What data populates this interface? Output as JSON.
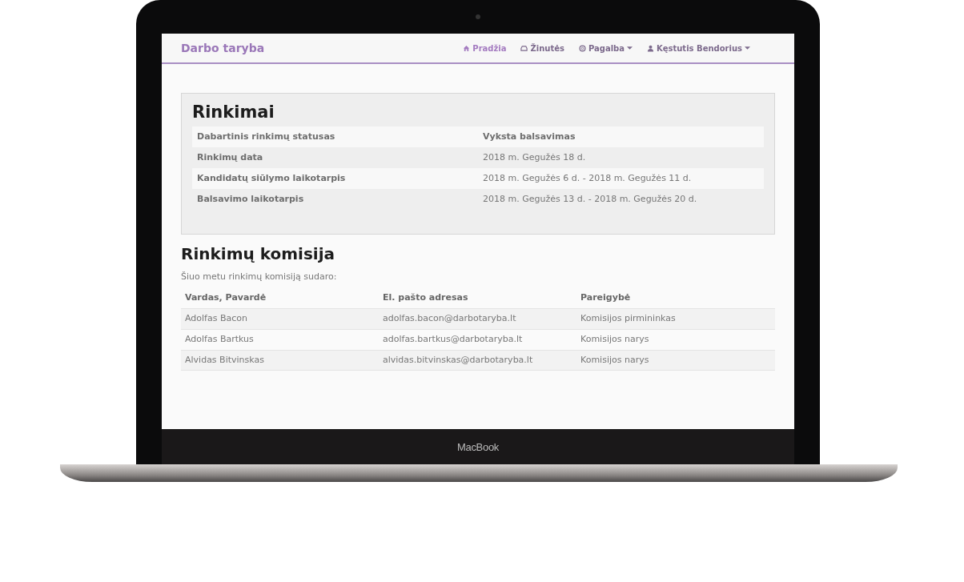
{
  "device": {
    "label": "MacBook"
  },
  "navbar": {
    "brand": "Darbo taryba",
    "items": [
      {
        "kind": "home",
        "label": "Pradžia",
        "dropdown": false
      },
      {
        "kind": "inbox",
        "label": "Žinutės",
        "dropdown": false
      },
      {
        "kind": "help",
        "label": "Pagalba",
        "dropdown": true
      },
      {
        "kind": "user",
        "label": "Kęstutis Bendorius",
        "dropdown": true
      }
    ]
  },
  "election": {
    "title": "Rinkimai",
    "rows": [
      {
        "label": "Dabartinis rinkimų statusas",
        "value": "Vyksta balsavimas",
        "bold": true
      },
      {
        "label": "Rinkimų data",
        "value": "2018 m. Gegužės 18 d.",
        "bold": false
      },
      {
        "label": "Kandidatų siūlymo laikotarpis",
        "value": "2018 m. Gegužės 6 d. - 2018 m. Gegužės 11 d.",
        "bold": false
      },
      {
        "label": "Balsavimo laikotarpis",
        "value": "2018 m. Gegužės 13 d. - 2018 m. Gegužės 20 d.",
        "bold": false
      }
    ]
  },
  "commission": {
    "title": "Rinkimų komisija",
    "intro": "Šiuo metu rinkimų komisiją sudaro:",
    "columns": [
      "Vardas, Pavardė",
      "El. pašto adresas",
      "Pareigybė"
    ],
    "rows": [
      [
        "Adolfas Bacon",
        "adolfas.bacon@darbotaryba.lt",
        "Komisijos pirmininkas"
      ],
      [
        "Adolfas Bartkus",
        "adolfas.bartkus@darbotaryba.lt",
        "Komisijos narys"
      ],
      [
        "Alvidas Bitvinskas",
        "alvidas.bitvinskas@darbotaryba.lt",
        "Komisijos narys"
      ]
    ]
  }
}
